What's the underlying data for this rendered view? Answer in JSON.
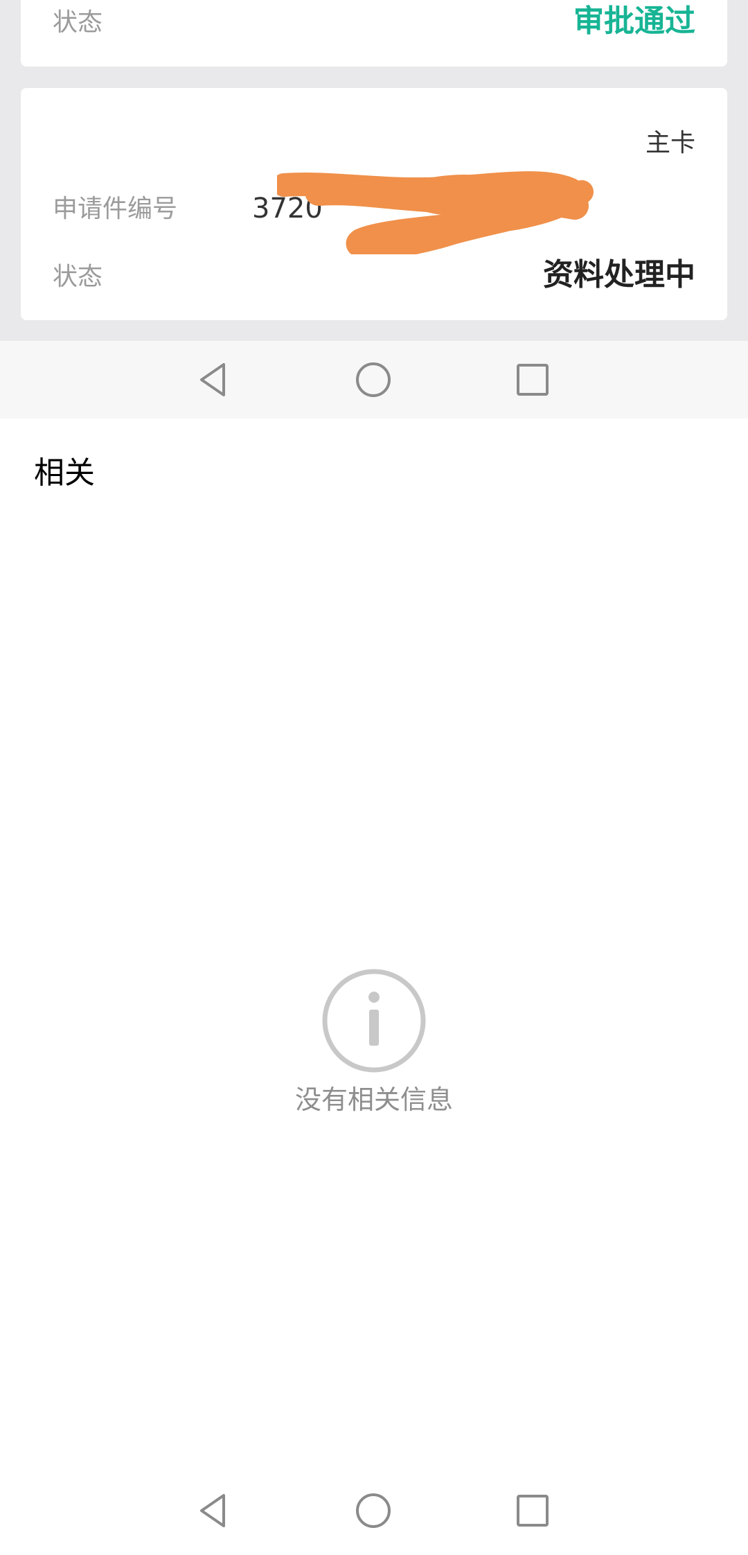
{
  "top_card": {
    "status_label": "状态",
    "status_value": "审批通过",
    "status_color": "#17b494"
  },
  "second_card": {
    "card_type": "主卡",
    "app_number_label": "申请件编号",
    "app_number_value": "3720",
    "status_label": "状态",
    "status_value": "资料处理中"
  },
  "redaction_color": "#f0904a",
  "related": {
    "title": "相关",
    "empty_text": "没有相关信息"
  },
  "icons": {
    "info": "info-circle-icon",
    "nav_back": "back-triangle-icon",
    "nav_home": "home-circle-icon",
    "nav_recent": "recent-square-icon"
  }
}
